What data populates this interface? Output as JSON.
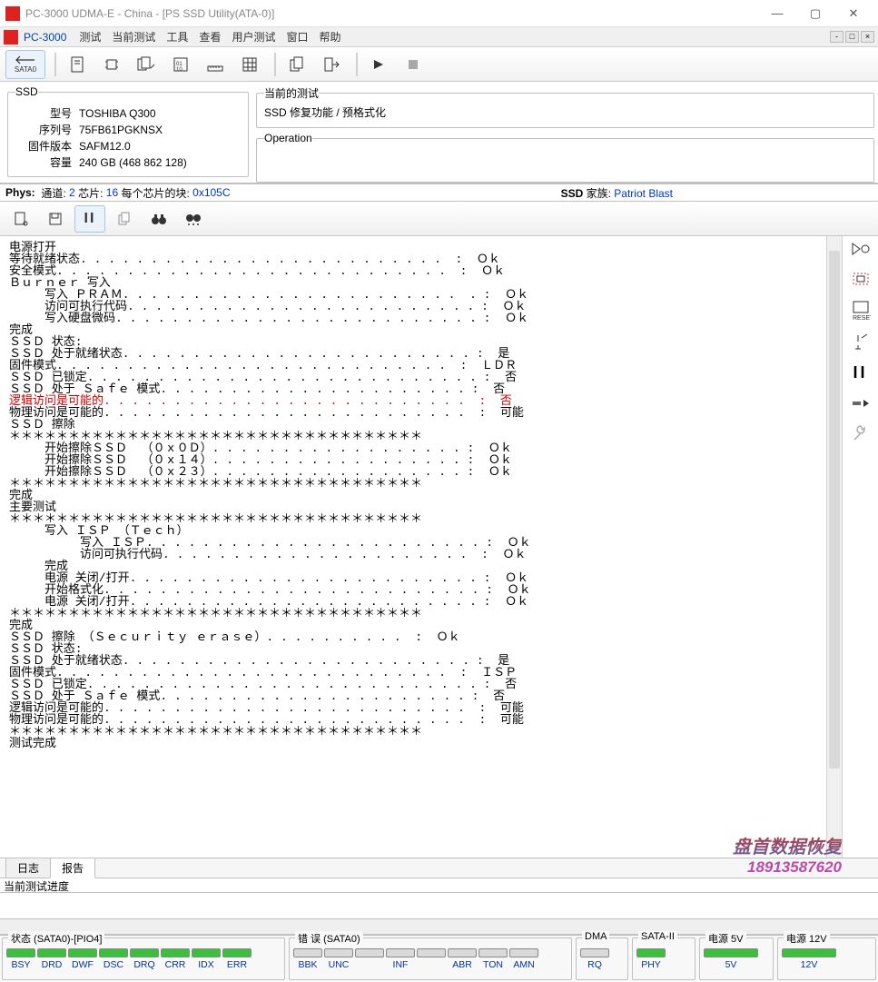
{
  "titlebar": {
    "title": "PC-3000 UDMA-E - China - [PS SSD Utility(ATA-0)]"
  },
  "menubar": {
    "app_label": "PC-3000",
    "items": [
      "测试",
      "当前测试",
      "工具",
      "查看",
      "用户测试",
      "窗口",
      "帮助"
    ]
  },
  "toolbar": {
    "sata_label": "SATA0"
  },
  "ssd_panel": {
    "legend": "SSD",
    "model_lbl": "型号",
    "model": "TOSHIBA Q300",
    "serial_lbl": "序列号",
    "serial": "75FB61PGKNSX",
    "fw_lbl": "固件版本",
    "fw": "SAFM12.0",
    "cap_lbl": "容量",
    "cap": "240 GB (468 862 128)"
  },
  "current_test": {
    "legend": "当前的测试",
    "text": "SSD 修复功能 / 预格式化"
  },
  "operation": {
    "legend": "Operation"
  },
  "phys": {
    "label": "Phys:",
    "ch_lbl": "通道:",
    "ch": "2",
    "chip_lbl": "芯片:",
    "chip": "16",
    "block_lbl": "每个芯片的块:",
    "block": "0x105C",
    "ssd_lbl": "SSD",
    "family_lbl": "家族:",
    "family": "Patriot Blast"
  },
  "log": {
    "lines": [
      "电源打开",
      "等待就绪状态. . . . . . . . . . . . . . . . . . . . . . . . . .  :  Ｏｋ",
      "安全模式. . . . . . . . . . . . . . . . . . . . . . . . . . . .  :  Ｏｋ",
      "",
      "Ｂｕｒｎｅｒ 写入",
      "     写入 ＰＲＡＭ. . . . . . . . . . . . . . . . . . . . . . . .  . :  Ｏｋ",
      "     访问可执行代码. . . . . . . . . . . . . . . . . . . . . . . . . :  Ｏｋ",
      "     写入硬盘微码. . . . . . . . . . . . . . . . . . . . . . . . . . :  Ｏｋ",
      "完成",
      "",
      "ＳＳＤ 状态:",
      "ＳＳＤ 处于就绪状态. . . . . . . . . . . . . . . . . . . . . . . . . :  是",
      "固件模式. . . . . . . . . . . . . . . . . . . . . . . . . . . .  :  ＬＤＲ",
      "ＳＳＤ 已锁定. . . . . . . . . . . . . . . . . . . . . . . . . . . . :  否",
      "ＳＳＤ 处于 Ｓａｆｅ 模式. . . . . . . . . . . . . . . . . . . . . . :  否",
      "逻辑访问是可能的. . . . . . . . . . . . . . . . . . . . . . . . . .  :  否",
      "物理访问是可能的. . . . . . . . . . . . . . . . . . . . . . . . . .  :  可能",
      "",
      "ＳＳＤ 擦除",
      "＊＊＊＊＊＊＊＊＊＊＊＊＊＊＊＊＊＊＊＊＊＊＊＊＊＊＊＊＊＊＊＊＊＊＊",
      "     开始擦除ＳＳＤ  （０ｘ０Ｄ）. . . . . . . . . . . . . . . . . . :  Ｏｋ",
      "     开始擦除ＳＳＤ  （０ｘ１４）. . . . . . . . . . . . . . . . . . :  Ｏｋ",
      "     开始擦除ＳＳＤ  （０ｘ２３）. . . . . . . . . . . . . . . . . . :  Ｏｋ",
      "＊＊＊＊＊＊＊＊＊＊＊＊＊＊＊＊＊＊＊＊＊＊＊＊＊＊＊＊＊＊＊＊＊＊＊",
      "完成",
      "",
      "主要测试",
      "＊＊＊＊＊＊＊＊＊＊＊＊＊＊＊＊＊＊＊＊＊＊＊＊＊＊＊＊＊＊＊＊＊＊＊",
      "     写入 ＩＳＰ （Ｔｅｃｈ）",
      "          写入 ＩＳＰ. . . . . . . . . . . . . . . . . . . . . . . . :  Ｏｋ",
      "          访问可执行代码. . . . . . . . . . . . . . . . . . . . . .  :  Ｏｋ",
      "     完成",
      "",
      "     电源 关闭/打开. . . . . . . . . . . . . . . . . . . . . . . . . :  Ｏｋ",
      "     开始格式化. . . . . . . . . . . . . . . . . . . . . . . . . . . :  Ｏｋ",
      "     电源 关闭/打开. . . . . . . . . . . . . . . . . . . . . . . . . :  Ｏｋ",
      "＊＊＊＊＊＊＊＊＊＊＊＊＊＊＊＊＊＊＊＊＊＊＊＊＊＊＊＊＊＊＊＊＊＊＊",
      "完成",
      "ＳＳＤ 擦除 （Ｓｅｃｕｒｉｔｙ ｅｒａｓｅ）. . . . . . . . . .  :  Ｏｋ",
      "",
      "ＳＳＤ 状态:",
      "ＳＳＤ 处于就绪状态. . . . . . . . . . . . . . . . . . . . . . . . . :  是",
      "固件模式. . . . . . . . . . . . . . . . . . . . . . . . . . . .  :  ＩＳＰ",
      "ＳＳＤ 已锁定. . . . . . . . . . . . . . . . . . . . . . . . . . . . :  否",
      "ＳＳＤ 处于 Ｓａｆｅ 模式. . . . . . . . . . . . . . . . . . . . . . :  否",
      "逻辑访问是可能的. . . . . . . . . . . . . . . . . . . . . . . . . .  :  可能",
      "物理访问是可能的. . . . . . . . . . . . . . . . . . . . . . . . . .  :  可能",
      "＊＊＊＊＊＊＊＊＊＊＊＊＊＊＊＊＊＊＊＊＊＊＊＊＊＊＊＊＊＊＊＊＊＊＊",
      "测试完成"
    ],
    "red_line_index": 15
  },
  "watermark": {
    "l1": "盘首数据恢复",
    "l2": "18913587620"
  },
  "tabs": {
    "log": "日志",
    "report": "报告"
  },
  "progress": {
    "label": "当前测试进度"
  },
  "status": {
    "g1_label": "状态 (SATA0)-[PIO4]",
    "g1": [
      "BSY",
      "DRD",
      "DWF",
      "DSC",
      "DRQ",
      "CRR",
      "IDX",
      "ERR"
    ],
    "g2_label": "错 误 (SATA0)",
    "g2": [
      "BBK",
      "UNC",
      "",
      "INF",
      "",
      "ABR",
      "TON",
      "AMN"
    ],
    "g3_label": "DMA",
    "g3": [
      "RQ"
    ],
    "g4_label": "SATA-II",
    "g4": [
      "PHY"
    ],
    "g5_label": "电源 5V",
    "g5": [
      "5V"
    ],
    "g6_label": "电源 12V",
    "g6": [
      "12V"
    ]
  }
}
